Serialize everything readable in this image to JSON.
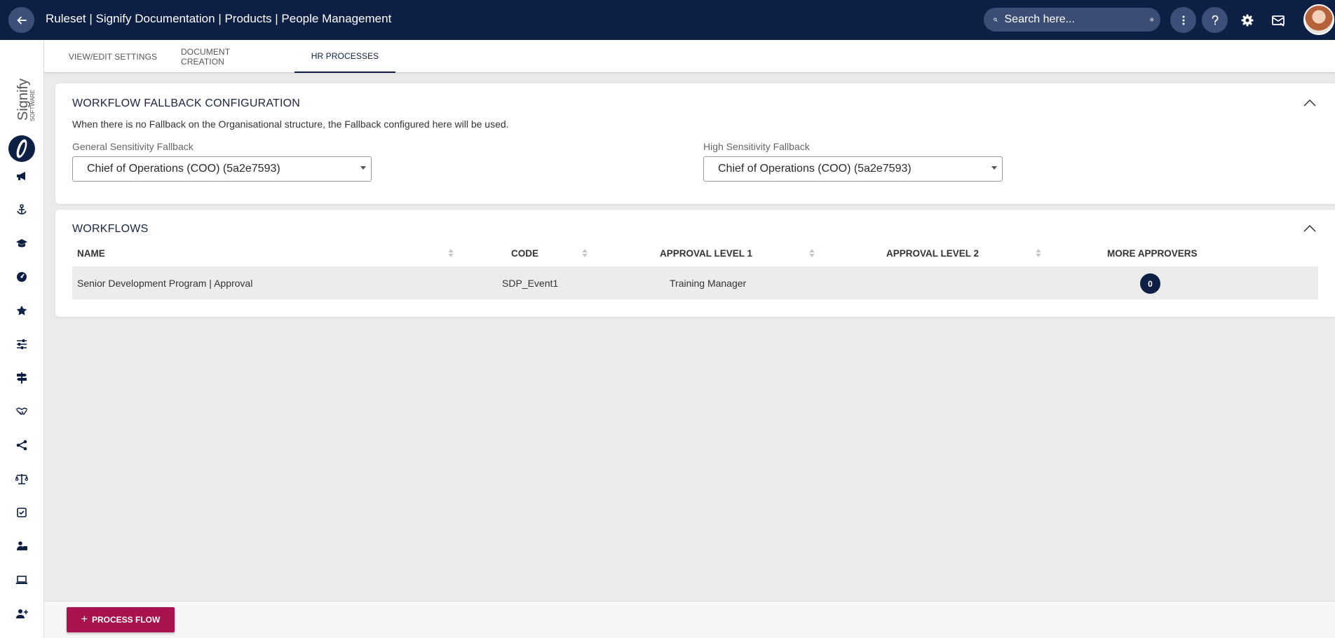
{
  "header": {
    "title": "Ruleset | Signify Documentation | Products | People Management",
    "search_placeholder": "Search here..."
  },
  "sidebar": {
    "logo_text": "Signify",
    "logo_subtext": "SOFTWARE",
    "items": [
      {
        "icon": "megaphone-icon"
      },
      {
        "icon": "anchor-icon"
      },
      {
        "icon": "graduation-cap-icon"
      },
      {
        "icon": "dashboard-gauge-icon"
      },
      {
        "icon": "star-icon"
      },
      {
        "icon": "sliders-icon"
      },
      {
        "icon": "signpost-icon"
      },
      {
        "icon": "handshake-icon"
      },
      {
        "icon": "hierarchy-icon"
      },
      {
        "icon": "scales-icon"
      },
      {
        "icon": "checkbox-icon"
      },
      {
        "icon": "person-briefcase-icon"
      },
      {
        "icon": "laptop-icon"
      },
      {
        "icon": "add-person-icon"
      }
    ]
  },
  "tabs": [
    {
      "label": "VIEW/EDIT SETTINGS",
      "active": false
    },
    {
      "label": "DOCUMENT CREATION",
      "active": false
    },
    {
      "label": "HR PROCESSES",
      "active": true
    }
  ],
  "fallback": {
    "title": "WORKFLOW FALLBACK CONFIGURATION",
    "description": "When there is no Fallback on the Organisational structure, the Fallback configured here will be used.",
    "general_label": "General Sensitivity Fallback",
    "general_value": "Chief of Operations (COO) (5a2e7593)",
    "high_label": "High Sensitivity Fallback",
    "high_value": "Chief of Operations (COO) (5a2e7593)"
  },
  "workflows": {
    "title": "WORKFLOWS",
    "columns": [
      "NAME",
      "CODE",
      "APPROVAL LEVEL 1",
      "APPROVAL LEVEL 2",
      "MORE APPROVERS"
    ],
    "rows": [
      {
        "name": "Senior Development Program | Approval",
        "code": "SDP_Event1",
        "level1": "Training Manager",
        "level2": "",
        "more": "0"
      }
    ]
  },
  "footer": {
    "process_flow_label": "PROCESS FLOW"
  },
  "colors": {
    "navy": "#0e1f45",
    "accent": "#a8134f"
  }
}
